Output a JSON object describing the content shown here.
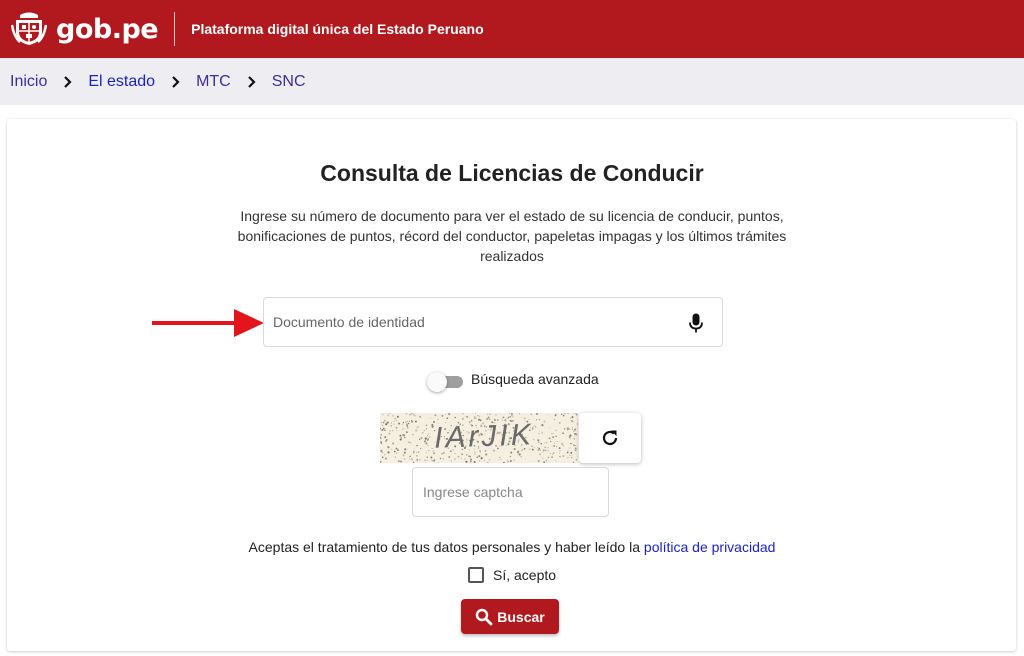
{
  "header": {
    "logo_text": "gob.pe",
    "tagline": "Plataforma digital única del Estado Peruano",
    "brand_color": "#b1191e"
  },
  "breadcrumb": [
    {
      "label": "Inicio"
    },
    {
      "label": "El estado"
    },
    {
      "label": "MTC"
    },
    {
      "label": "SNC"
    }
  ],
  "main": {
    "title": "Consulta de Licencias de Conducir",
    "description": "Ingrese su número de documento para ver el estado de su licencia de conducir, puntos, bonificaciones de puntos, récord del conductor, papeletas impagas y los últimos trámites realizados"
  },
  "document_field": {
    "placeholder": "Documento de identidad",
    "value": "",
    "icon": "microphone-icon"
  },
  "advanced_search": {
    "label": "Búsqueda avanzada",
    "enabled": false
  },
  "captcha": {
    "image_text": "IArJIK",
    "refresh_icon": "refresh-icon",
    "placeholder": "Ingrese captcha",
    "value": ""
  },
  "privacy": {
    "text": "Aceptas el tratamiento de tus datos personales y haber leído la",
    "link_label": "política de privacidad"
  },
  "accept": {
    "label": "Sí, acepto",
    "checked": false
  },
  "search_button": {
    "label": "Buscar",
    "icon": "search-icon"
  },
  "annotation": {
    "arrow_color": "#e3141b"
  }
}
